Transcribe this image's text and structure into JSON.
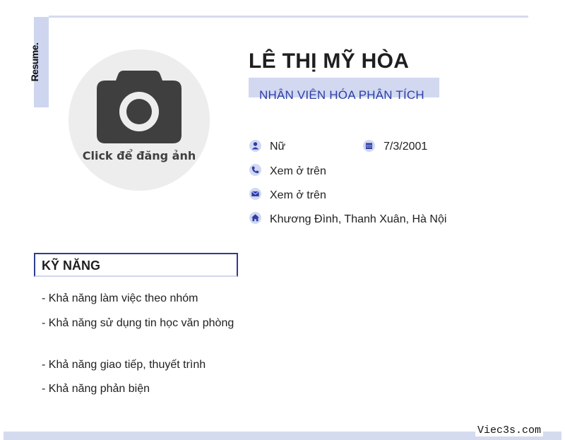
{
  "header": {
    "resume_label": "Resume.",
    "name": "LÊ THỊ MỸ HÒA",
    "job_title": "NHÂN VIÊN HÓA PHÂN TÍCH"
  },
  "photo": {
    "caption": "Click để đăng ảnh",
    "icon": "camera-icon"
  },
  "info": {
    "gender": {
      "icon": "person-icon",
      "value": "Nữ"
    },
    "birthday": {
      "icon": "calendar-icon",
      "value": "7/3/2001"
    },
    "phone": {
      "icon": "phone-icon",
      "value": "Xem ở trên"
    },
    "email": {
      "icon": "mail-icon",
      "value": "Xem ở trên"
    },
    "address": {
      "icon": "home-icon",
      "value": "Khương Đình, Thanh Xuân, Hà Nội"
    }
  },
  "skills": {
    "title": "KỸ NĂNG",
    "items": [
      "- Khả năng làm việc theo nhóm",
      "- Khả năng sử dụng tin học văn phòng",
      "- Khả năng giao tiếp, thuyết trình",
      "- Khả năng phản biện"
    ]
  },
  "footer": {
    "watermark": "Viec3s.com"
  },
  "colors": {
    "accent_light": "#d2d8f0",
    "accent_dark": "#2f3c8f",
    "title_text": "#2d3ea8"
  }
}
